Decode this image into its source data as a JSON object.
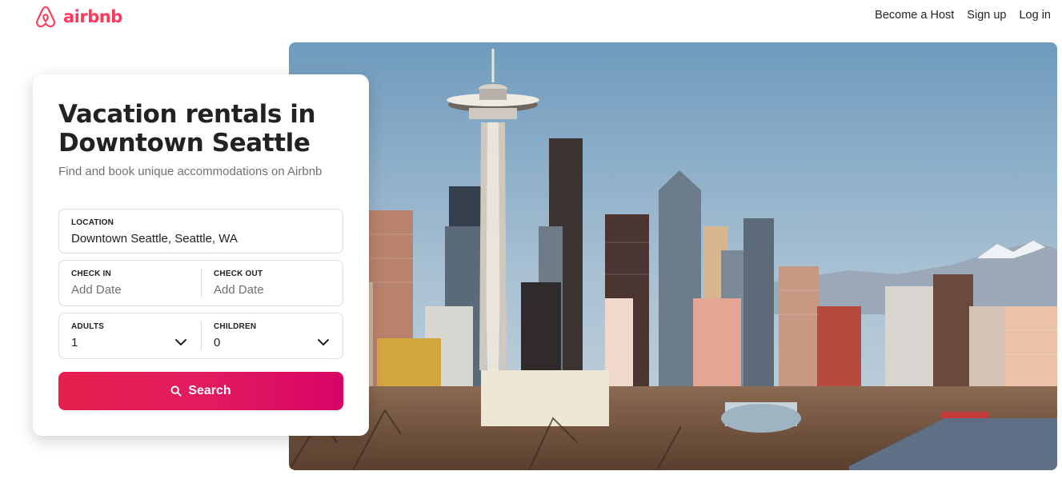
{
  "brand": {
    "name": "airbnb",
    "color": "#ff385c",
    "logo_icon": "airbnb-belo-icon"
  },
  "nav": {
    "become_host": "Become a Host",
    "sign_up": "Sign up",
    "log_in": "Log in"
  },
  "card": {
    "title": "Vacation rentals in Downtown Seattle",
    "subtitle": "Find and book unique accommodations on Airbnb"
  },
  "search": {
    "location": {
      "label": "LOCATION",
      "value": "Downtown Seattle, Seattle, WA"
    },
    "check_in": {
      "label": "CHECK IN",
      "placeholder": "Add Date"
    },
    "check_out": {
      "label": "CHECK OUT",
      "placeholder": "Add Date"
    },
    "adults": {
      "label": "ADULTS",
      "value": "1",
      "icon": "chevron-down-icon"
    },
    "children": {
      "label": "CHILDREN",
      "value": "0",
      "icon": "chevron-down-icon"
    },
    "button_label": "Search",
    "button_icon": "search-icon",
    "button_gradient": [
      "#e61e4d",
      "#d70466"
    ]
  },
  "hero": {
    "subject": "Seattle skyline with Space Needle",
    "icon": "hero-photo"
  }
}
